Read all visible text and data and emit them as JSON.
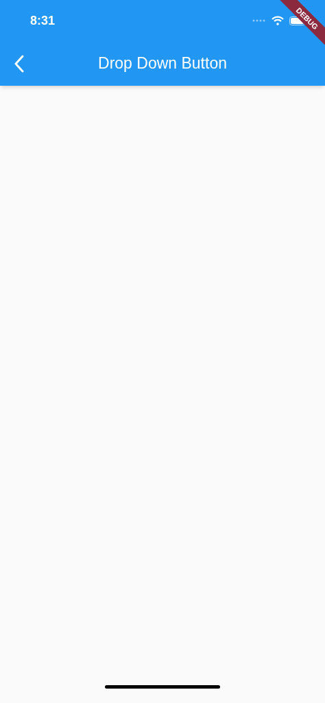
{
  "status_bar": {
    "time": "8:31"
  },
  "app_bar": {
    "title": "Drop Down Button"
  },
  "debug_banner": {
    "label": "DEBUG"
  }
}
